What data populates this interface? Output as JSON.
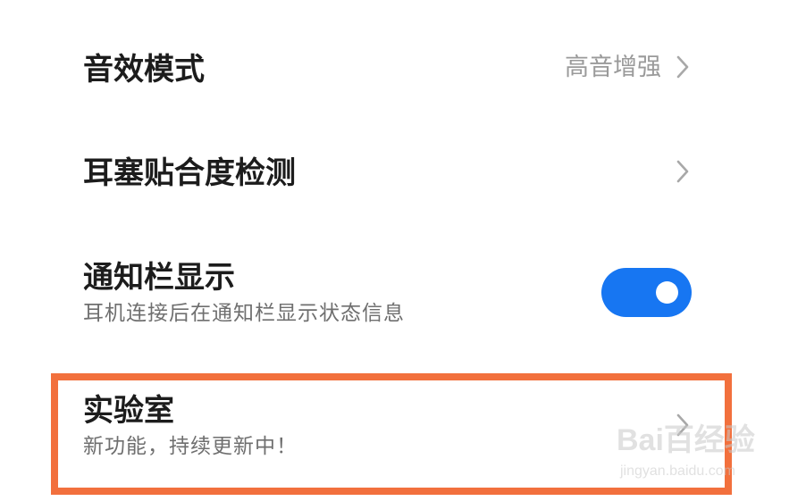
{
  "settings": {
    "items": [
      {
        "title": "音效模式",
        "value": "高音增强",
        "icon": "chevron-right-icon"
      },
      {
        "title": "耳塞贴合度检测",
        "icon": "chevron-right-icon"
      },
      {
        "title": "通知栏显示",
        "subtitle": "耳机连接后在通知栏显示状态信息",
        "toggle_on": true
      },
      {
        "title": "实验室",
        "subtitle": "新功能，持续更新中！",
        "icon": "chevron-right-icon"
      }
    ]
  },
  "watermark": {
    "logo": "Bai百经验",
    "url": "jingyan.baidu.com"
  },
  "colors": {
    "toggle_on": "#1776f2",
    "highlight": "#f2703d",
    "title": "#1c1c1c",
    "subtitle": "#6f6f6f",
    "value": "#9a9a9a"
  }
}
